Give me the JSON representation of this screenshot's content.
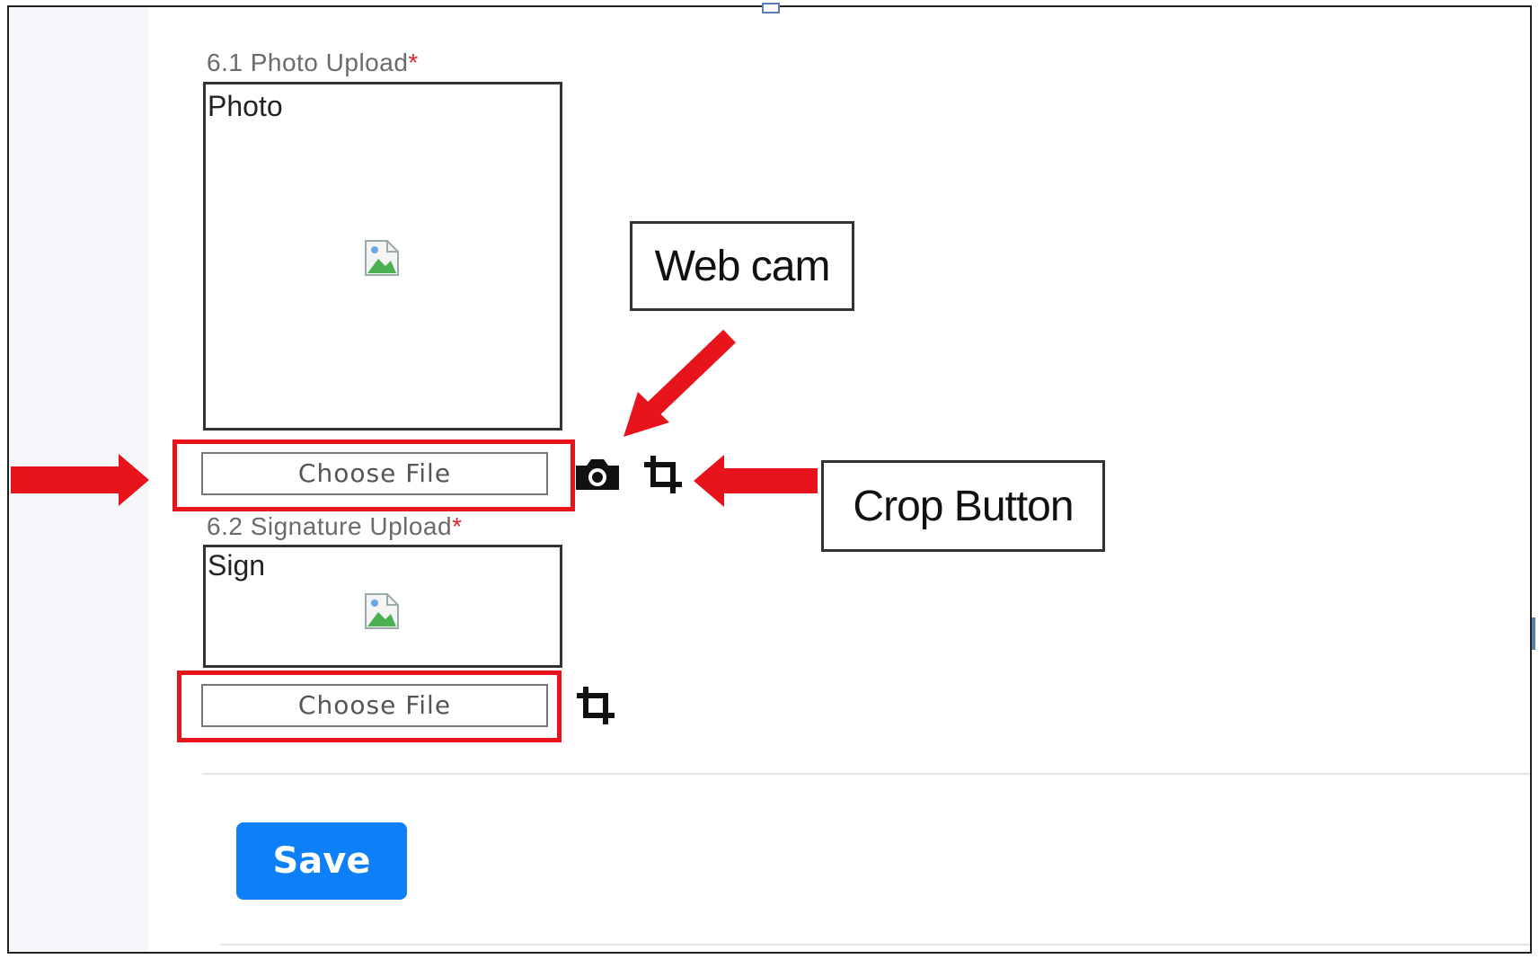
{
  "photo_section": {
    "label": "6.1 Photo Upload",
    "required_mark": "*",
    "preview_alt": "Photo",
    "choose_file_label": "Choose File"
  },
  "signature_section": {
    "label": "6.2 Signature Upload",
    "required_mark": "*",
    "preview_alt": "Sign",
    "choose_file_label": "Choose File"
  },
  "annotations": {
    "webcam_callout": "Web cam",
    "crop_callout": "Crop Button",
    "highlight_color": "#e8141b"
  },
  "form": {
    "save_label": "Save",
    "save_color": "#0d7ff7"
  },
  "icons": {
    "webcam": "camera-icon",
    "crop": "crop-icon",
    "broken_image": "broken-image-icon"
  }
}
